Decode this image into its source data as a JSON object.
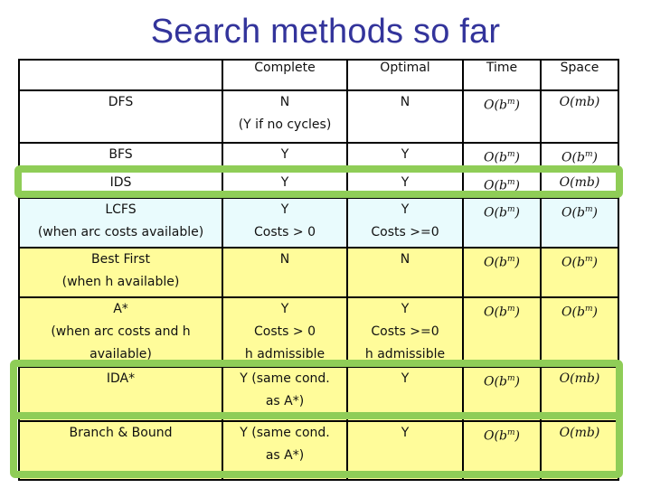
{
  "title": "Search methods so far",
  "columns": [
    "",
    "Complete",
    "Optimal",
    "Time",
    "Space"
  ],
  "rows": [
    {
      "name": [
        "DFS"
      ],
      "complete": [
        "N",
        "(Y if no cycles)"
      ],
      "optimal": [
        "N"
      ],
      "time": "O(b^m)",
      "space": "O(mb)",
      "bg": "white"
    },
    {
      "name": [
        "BFS"
      ],
      "complete": [
        "Y"
      ],
      "optimal": [
        "Y"
      ],
      "time": "O(b^m)",
      "space": "O(b^m)",
      "bg": "white"
    },
    {
      "name": [
        "IDS"
      ],
      "complete": [
        "Y"
      ],
      "optimal": [
        "Y"
      ],
      "time": "O(b^m)",
      "space": "O(mb)",
      "bg": "white",
      "highlighted": true
    },
    {
      "name": [
        "LCFS",
        "(when arc costs available)"
      ],
      "complete": [
        "Y",
        "Costs > 0"
      ],
      "optimal": [
        "Y",
        "Costs >=0"
      ],
      "time": "O(b^m)",
      "space": "O(b^m)",
      "bg": "cyan"
    },
    {
      "name": [
        "Best First",
        "(when h available)"
      ],
      "complete": [
        "N"
      ],
      "optimal": [
        "N"
      ],
      "time": "O(b^m)",
      "space": "O(b^m)",
      "bg": "yellow"
    },
    {
      "name": [
        "A*",
        "(when arc costs and h",
        "available)"
      ],
      "complete": [
        "Y",
        "Costs > 0",
        "h admissible"
      ],
      "optimal": [
        "Y",
        "Costs >=0",
        "h admissible"
      ],
      "time": "O(b^m)",
      "space": "O(b^m)",
      "bg": "yellow"
    },
    {
      "name": [
        "IDA*"
      ],
      "complete": [
        "Y (same cond.",
        "as A*)"
      ],
      "optimal": [
        "Y"
      ],
      "time": "O(b^m)",
      "space": "O(mb)",
      "bg": "yellow",
      "highlighted": true
    },
    {
      "name": [
        "Branch & Bound"
      ],
      "complete": [
        "Y (same cond.",
        "as A*)"
      ],
      "optimal": [
        "Y"
      ],
      "time": "O(b^m)",
      "space": "O(mb)",
      "bg": "yellow",
      "highlighted": true
    }
  ],
  "colors": {
    "title": "#33349b",
    "highlight": "#8fcd57",
    "cyan_row": "#e9fbfd",
    "yellow_row": "#fffc9a"
  }
}
